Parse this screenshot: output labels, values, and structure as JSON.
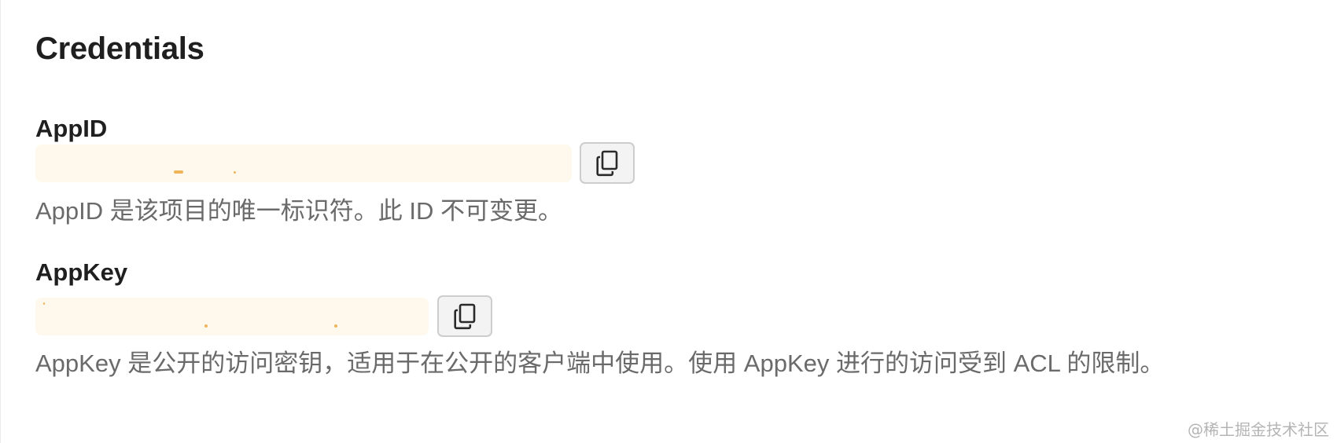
{
  "section": {
    "title": "Credentials"
  },
  "fields": [
    {
      "label": "AppID",
      "value": "",
      "help": "AppID 是该项目的唯一标识符。此 ID 不可变更。",
      "copy_icon": "copy-icon"
    },
    {
      "label": "AppKey",
      "value": "",
      "help": "AppKey 是公开的访问密钥，适用于在公开的客户端中使用。使用 AppKey 进行的访问受到 ACL 的限制。",
      "copy_icon": "copy-icon"
    }
  ],
  "watermark": "@稀土掘金技术社区",
  "colors": {
    "masked_background": "#fef9ec",
    "masked_speck": "#f0b458",
    "heading": "#1f1f1f",
    "help_text": "#6a6a6a",
    "button_background": "#f3f3f3",
    "button_border": "#cdcdcd"
  }
}
